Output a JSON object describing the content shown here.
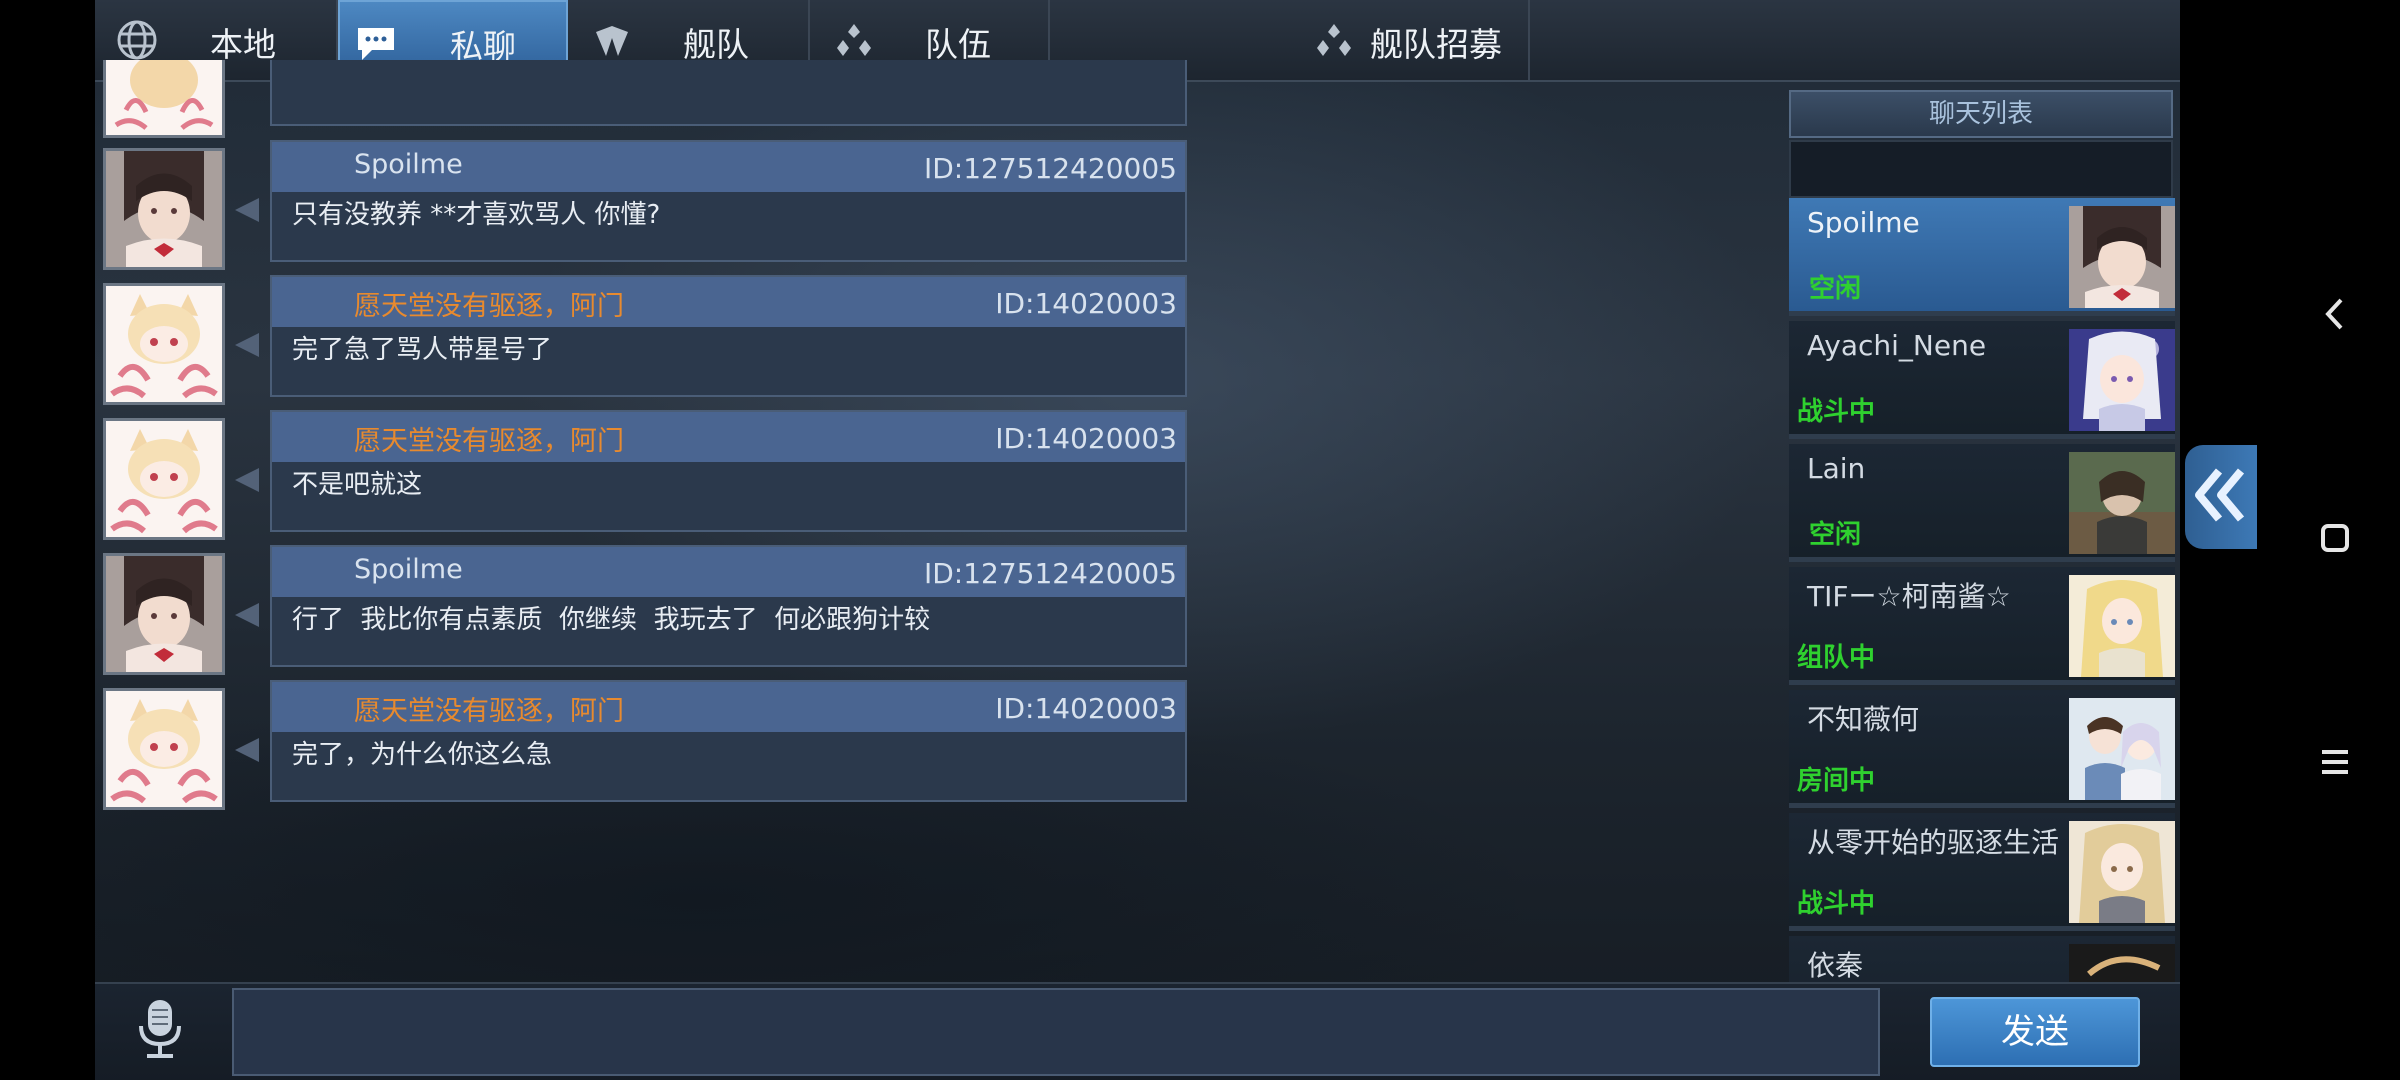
{
  "tabs": [
    {
      "label": "本地",
      "icon": "globe-icon"
    },
    {
      "label": "私聊",
      "icon": "chat-bubble-icon",
      "active": true
    },
    {
      "label": "舰队",
      "icon": "fleet-icon"
    },
    {
      "label": "队伍",
      "icon": "team-icon"
    },
    {
      "label": "舰队招募",
      "icon": "recruit-icon"
    }
  ],
  "messages": [
    {
      "sender": "Spoilme",
      "sender_color": "#d9e3ef",
      "id": "ID:127512420005",
      "text": "只有没教养 **才喜欢骂人 你懂?",
      "avatar": "spoilme"
    },
    {
      "sender": "愿天堂没有驱逐，阿门",
      "sender_color": "#e88a2e",
      "id": "ID:14020003",
      "text": "完了急了骂人带星号了",
      "avatar": "chibi"
    },
    {
      "sender": "愿天堂没有驱逐，阿门",
      "sender_color": "#e88a2e",
      "id": "ID:14020003",
      "text": "不是吧就这",
      "avatar": "chibi"
    },
    {
      "sender": "Spoilme",
      "sender_color": "#d9e3ef",
      "id": "ID:127512420005",
      "text": "行了  我比你有点素质  你继续  我玩去了  何必跟狗计较",
      "avatar": "spoilme"
    },
    {
      "sender": "愿天堂没有驱逐，阿门",
      "sender_color": "#e88a2e",
      "id": "ID:14020003",
      "text": "完了，为什么你这么急",
      "avatar": "chibi"
    }
  ],
  "chat_list": {
    "header": "聊天列表",
    "items": [
      {
        "name": "Spoilme",
        "status": "空闲",
        "selected": true
      },
      {
        "name": "Ayachi_Nene",
        "status": "战斗中"
      },
      {
        "name": "Lain",
        "status": "空闲"
      },
      {
        "name": "TIFー☆柯南酱☆",
        "status": "组队中"
      },
      {
        "name": "不知薇何",
        "status": "房间中"
      },
      {
        "name": "从零开始的驱逐生活",
        "status": "战斗中"
      },
      {
        "name": "依秦",
        "status": ""
      }
    ]
  },
  "input": {
    "value": "",
    "placeholder": ""
  },
  "send_label": "发送",
  "colors": {
    "accent": "#3d79b6",
    "status_green": "#2fd12f",
    "sender_orange": "#e88a2e"
  }
}
